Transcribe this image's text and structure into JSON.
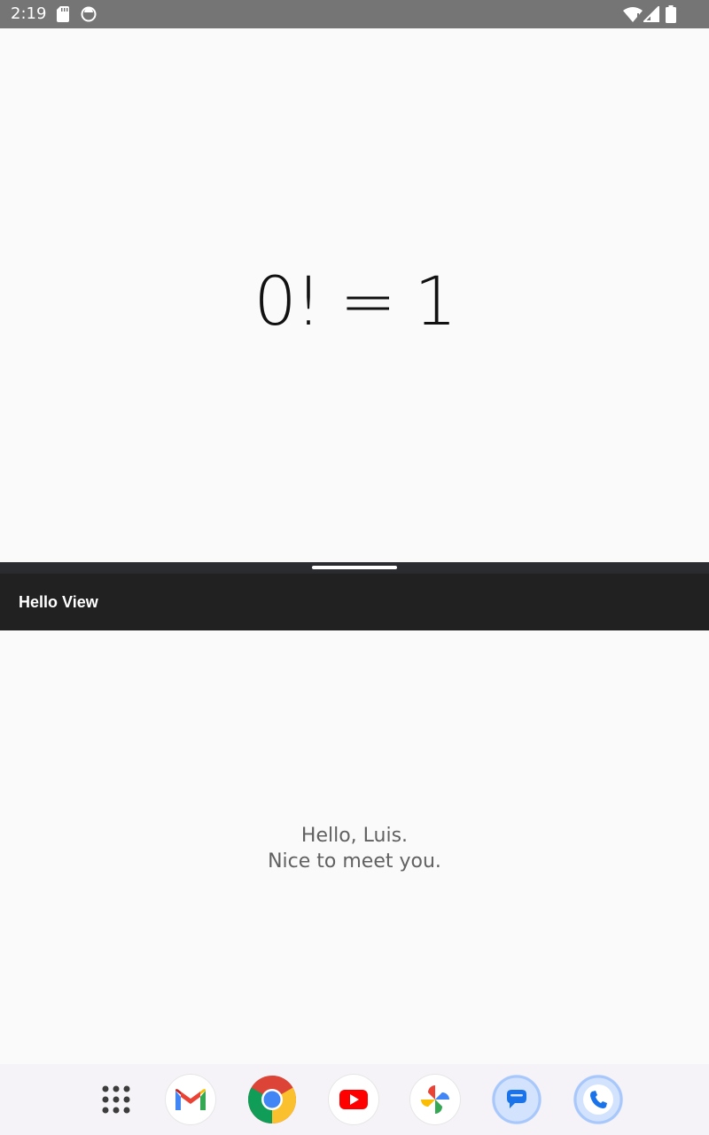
{
  "status_bar": {
    "time": "2:19",
    "icons": [
      "sd-card-icon",
      "sync-icon",
      "wifi-icon",
      "signal-icon",
      "battery-icon"
    ]
  },
  "top_app": {
    "result_text": "0! = 1"
  },
  "bottom_app": {
    "title": "Hello View",
    "greeting_line1": "Hello, Luis.",
    "greeting_line2": "Nice to meet you."
  },
  "dock": {
    "apps": [
      "apps-icon",
      "gmail-icon",
      "chrome-icon",
      "youtube-icon",
      "photos-icon",
      "messages-icon",
      "phone-icon"
    ]
  },
  "colors": {
    "status_bar_bg": "#757575",
    "app_bar_bg": "#212121",
    "divider_bg": "#2b2c30",
    "background": "#fafafa",
    "greeting_text": "#616161"
  }
}
